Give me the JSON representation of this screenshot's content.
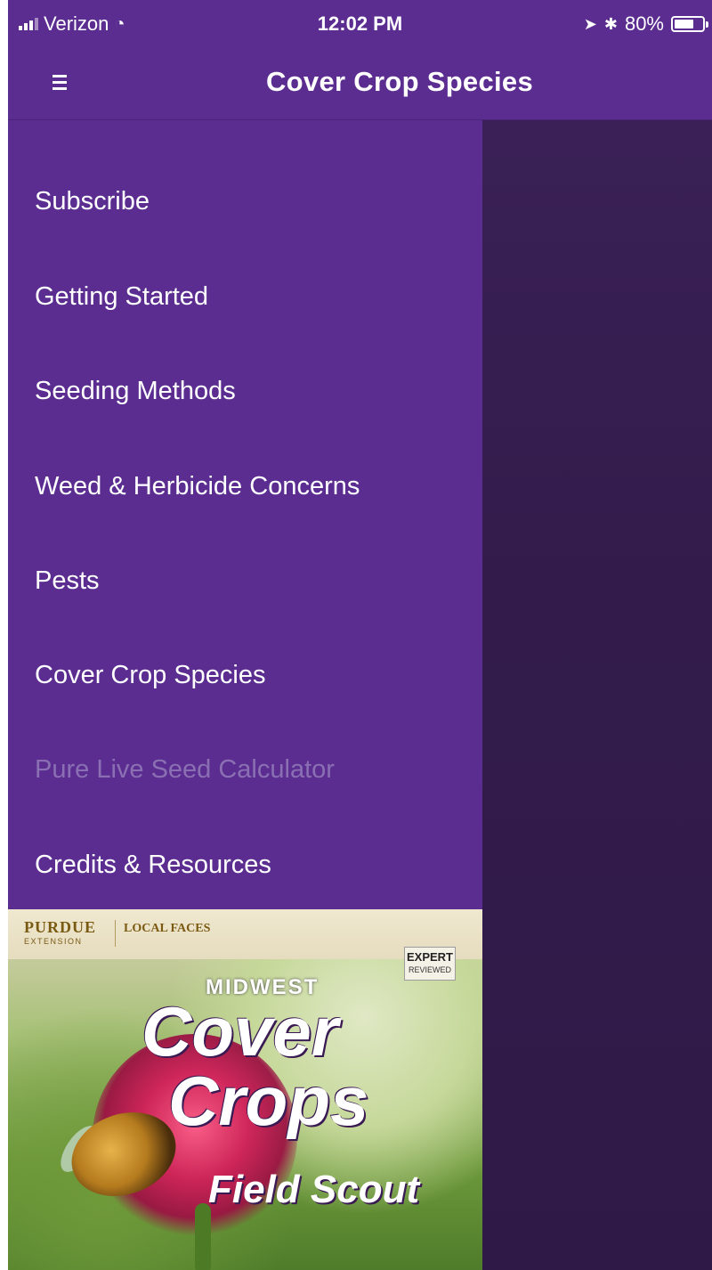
{
  "status_bar": {
    "carrier": "Verizon",
    "time": "12:02 PM",
    "battery": "80%",
    "battery_level": 0.8
  },
  "nav": {
    "title": "Cover Crop Species",
    "menu_icon": "hamburger-icon"
  },
  "drawer": {
    "items": [
      {
        "label": "Subscribe"
      },
      {
        "label": "Getting Started"
      },
      {
        "label": "Seeding Methods"
      },
      {
        "label": "Weed & Herbicide Concerns"
      },
      {
        "label": "Pests"
      },
      {
        "label": "Cover Crop Species"
      },
      {
        "label": "Pure Live Seed Calculator",
        "disabled": true
      },
      {
        "label": "Credits & Resources"
      }
    ]
  },
  "banner": {
    "publisher": "PURDUE",
    "publisher_sub": "EXTENSION",
    "partner": "LOCAL FACES",
    "badge_line1": "EXPERT",
    "badge_line2": "REVIEWED",
    "line1": "MIDWEST",
    "line2": "Cover",
    "line3": "Crops",
    "line4": "Field Scout"
  },
  "colors": {
    "primary": "#5c2d91",
    "overlay": "#351d4f",
    "disabled_text": "#8a70b3"
  }
}
